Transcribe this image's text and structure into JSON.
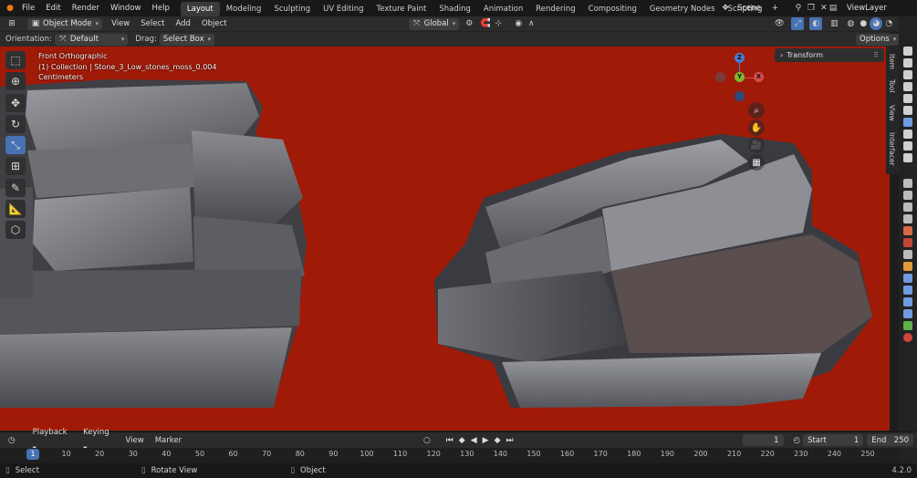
{
  "topbar": {
    "menus": [
      "File",
      "Edit",
      "Render",
      "Window",
      "Help"
    ],
    "workspace_tabs": [
      "Layout",
      "Modeling",
      "Sculpting",
      "UV Editing",
      "Texture Paint",
      "Shading",
      "Animation",
      "Rendering",
      "Compositing",
      "Geometry Nodes",
      "Scripting"
    ],
    "active_tab": "Layout",
    "scene": "Scene",
    "view_layer": "ViewLayer"
  },
  "header": {
    "mode": "Object Mode",
    "menus": [
      "View",
      "Select",
      "Add",
      "Object"
    ],
    "transform_orientation": "Global"
  },
  "tool_settings": {
    "orientation_label": "Orientation:",
    "orientation_value": "Default",
    "drag_label": "Drag:",
    "drag_value": "Select Box",
    "options_label": "Options"
  },
  "viewport": {
    "view_name": "Front Orthographic",
    "collection": "(1) Collection | Stone_3_Low_stones_moss_0.004",
    "units": "Centimeters",
    "background_color": "#a01a08",
    "gizmo_axes": {
      "z": "Z",
      "y": "Y",
      "x": "X"
    },
    "transform_panel_title": "Transform",
    "sidebar_tabs": [
      "Item",
      "Tool",
      "View",
      "Interfacer"
    ]
  },
  "timeline": {
    "menus": [
      "Playback",
      "Keying",
      "View",
      "Marker"
    ],
    "current_frame": "1",
    "start_label": "Start",
    "start_value": "1",
    "end_label": "End",
    "end_value": "250",
    "ruler_ticks": [
      "10",
      "20",
      "30",
      "40",
      "50",
      "60",
      "70",
      "80",
      "90",
      "100",
      "110",
      "120",
      "130",
      "140",
      "150",
      "160",
      "170",
      "180",
      "190",
      "200",
      "210",
      "220",
      "230",
      "240",
      "250"
    ],
    "ruler_current": "1"
  },
  "statusbar": {
    "select": "Select",
    "rotate_view": "Rotate View",
    "object": "Object",
    "version": "4.2.0"
  }
}
